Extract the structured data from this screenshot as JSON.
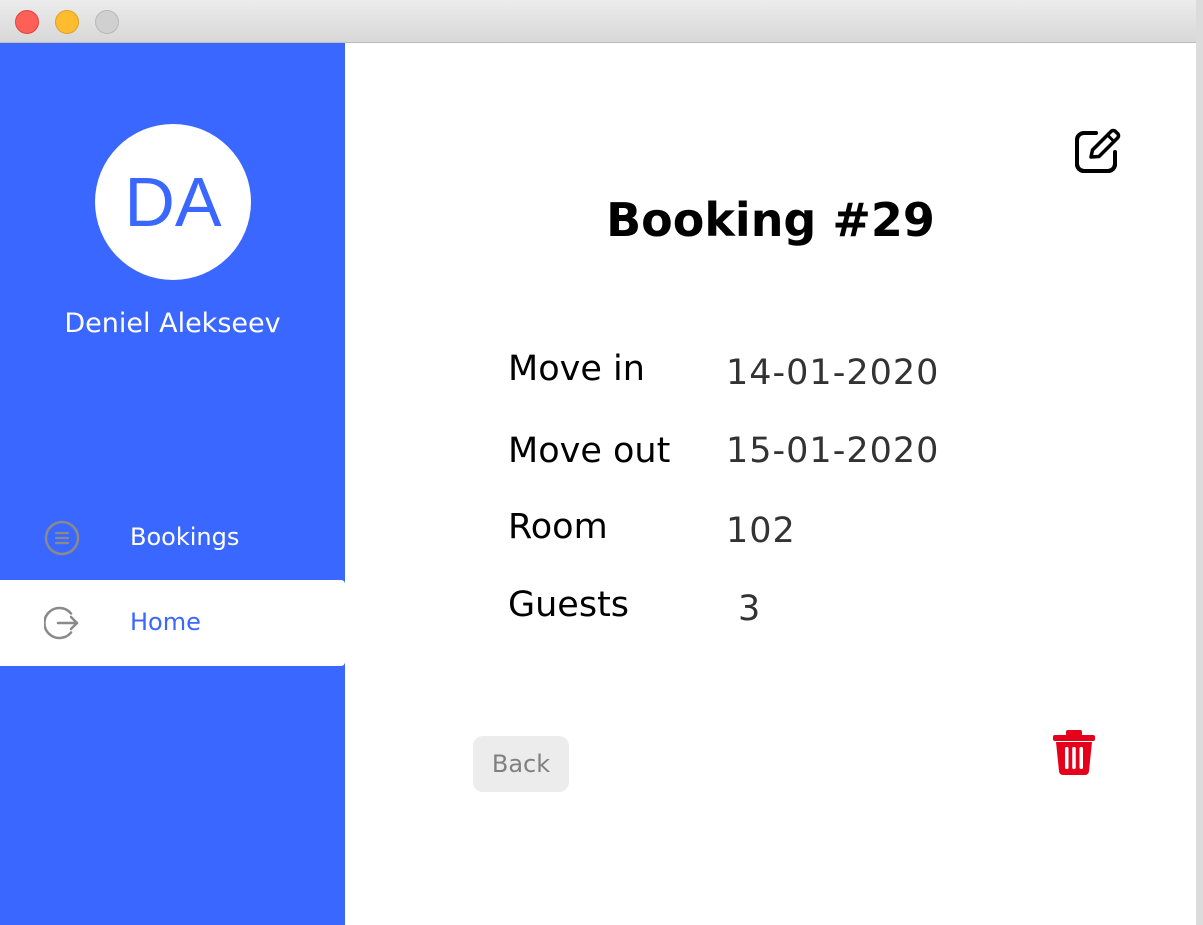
{
  "window": {
    "close": "close",
    "minimize": "minimize",
    "maximize": "maximize"
  },
  "sidebar": {
    "avatar_initials": "DA",
    "user_name": "Deniel Alekseev",
    "nav": [
      {
        "label": "Bookings",
        "icon": "list-icon",
        "active": false
      },
      {
        "label": "Home",
        "icon": "logout-icon",
        "active": true
      }
    ]
  },
  "booking": {
    "title": "Booking #29",
    "fields": [
      {
        "label": "Move in",
        "value": "14-01-2020"
      },
      {
        "label": "Move out",
        "value": "15-01-2020"
      },
      {
        "label": "Room",
        "value": "102"
      },
      {
        "label": "Guests",
        "value": "3"
      }
    ]
  },
  "actions": {
    "back_label": "Back",
    "edit_icon": "edit-icon",
    "delete_icon": "trash-icon"
  },
  "colors": {
    "sidebar": "#3967ff",
    "delete": "#e5001b",
    "button_bg": "#ececec"
  }
}
